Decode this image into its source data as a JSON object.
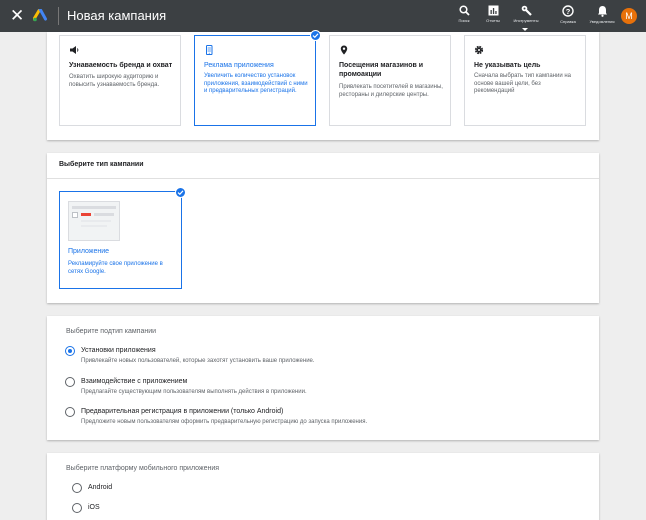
{
  "header": {
    "title": "Новая кампания",
    "icons": [
      {
        "icon": "search-icon",
        "label": "Поиск"
      },
      {
        "icon": "reports-icon",
        "label": "Отчеты"
      },
      {
        "icon": "tools-icon",
        "label": "Инструменты"
      },
      {
        "icon": "help-icon",
        "label": "Справка"
      },
      {
        "icon": "bell-icon",
        "label": "Уведомления"
      }
    ],
    "avatar_letter": "М",
    "colors": {
      "bar": "#3c4043",
      "avatar": "#e8710a"
    }
  },
  "goals": [
    {
      "icon": "megaphone-icon",
      "title": "Узнаваемость бренда и охват",
      "desc": "Охватить широкую аудиторию и повысить узнаваемость бренда.",
      "selected": false
    },
    {
      "icon": "phone-icon",
      "title": "Реклама приложения",
      "desc": "Увеличить количество установок приложения, взаимодействий с ними и предварительных регистраций.",
      "selected": true
    },
    {
      "icon": "location-pin-icon",
      "title": "Посещения магазинов и промоакции",
      "desc": "Привлекать посетителей в магазины, рестораны и дилерские центры.",
      "selected": false
    },
    {
      "icon": "gear-icon",
      "title": "Не указывать цель",
      "desc": "Сначала выбрать тип кампании на основе вашей цели, без рекомендаций",
      "selected": false
    }
  ],
  "campaign_type": {
    "section_title": "Выберите тип кампании",
    "card_title": "Приложение",
    "card_desc": "Рекламируйте свое приложение в сетях Google.",
    "selected": true
  },
  "subtype": {
    "header": "Выберите подтип кампании",
    "options": [
      {
        "label": "Установки приложения",
        "desc": "Привлекайте новых пользователей, которые захотят установить ваше приложение.",
        "checked": true
      },
      {
        "label": "Взаимодействие с приложением",
        "desc": "Предлагайте существующим пользователям выполнять действия в приложении.",
        "checked": false
      },
      {
        "label": "Предварительная регистрация в приложении (только Android)",
        "desc": "Предложите новым пользователям оформить предварительную регистрацию до запуска приложения.",
        "checked": false
      }
    ]
  },
  "platform": {
    "header": "Выберите платформу мобильного приложения",
    "options": [
      {
        "label": "Android",
        "checked": false
      },
      {
        "label": "iOS",
        "checked": false
      }
    ]
  },
  "accent_color": "#1a73e8"
}
